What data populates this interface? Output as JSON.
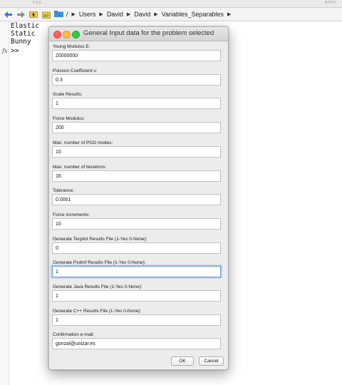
{
  "header": {
    "file_tab": "FILE",
    "apps_tab": "APPS"
  },
  "toolbar": {
    "back_icon": "back-arrow-icon",
    "forward_icon": "forward-arrow-icon",
    "up_icon": "up-folder-icon",
    "browse_icon": "browse-folder-icon",
    "folder_icon": "folder-icon",
    "path": [
      "/",
      "Users",
      "David",
      "David",
      "Variables_Separables"
    ]
  },
  "command_window": {
    "lines": "Elastic\nStatic\nBunny",
    "fx": "fx",
    "prompt": ">>"
  },
  "dialog": {
    "title": "General Input data for the problem selected",
    "fields": [
      {
        "label": "Young Modulus E:",
        "value": "20000000"
      },
      {
        "label": "Poisson Coefficient ν:",
        "value": "0.3"
      },
      {
        "label": "Scale Results:",
        "value": "1"
      },
      {
        "label": "Force Modulus:",
        "value": "200"
      },
      {
        "label": "Max. number of PGD modes:",
        "value": "10"
      },
      {
        "label": "Max. number of iterations:",
        "value": "16"
      },
      {
        "label": "Tolerance:",
        "value": "0.0001"
      },
      {
        "label": "Force increments:",
        "value": "10"
      },
      {
        "label": "Generate Tecplot Results File (1-Yes 0-None):",
        "value": "0"
      },
      {
        "label": "Generate Pxdmf Results File (1-Yes 0-None):",
        "value": "1"
      },
      {
        "label": "Generate Java Results File (1-Yes 0-None):",
        "value": "1"
      },
      {
        "label": "Generate C++ Results File (1-Yes 0-None):",
        "value": "1"
      },
      {
        "label": "Confirmation e-mail:",
        "value": "gonzal@unizar.es"
      }
    ],
    "ok_label": "OK",
    "cancel_label": "Cancel"
  }
}
